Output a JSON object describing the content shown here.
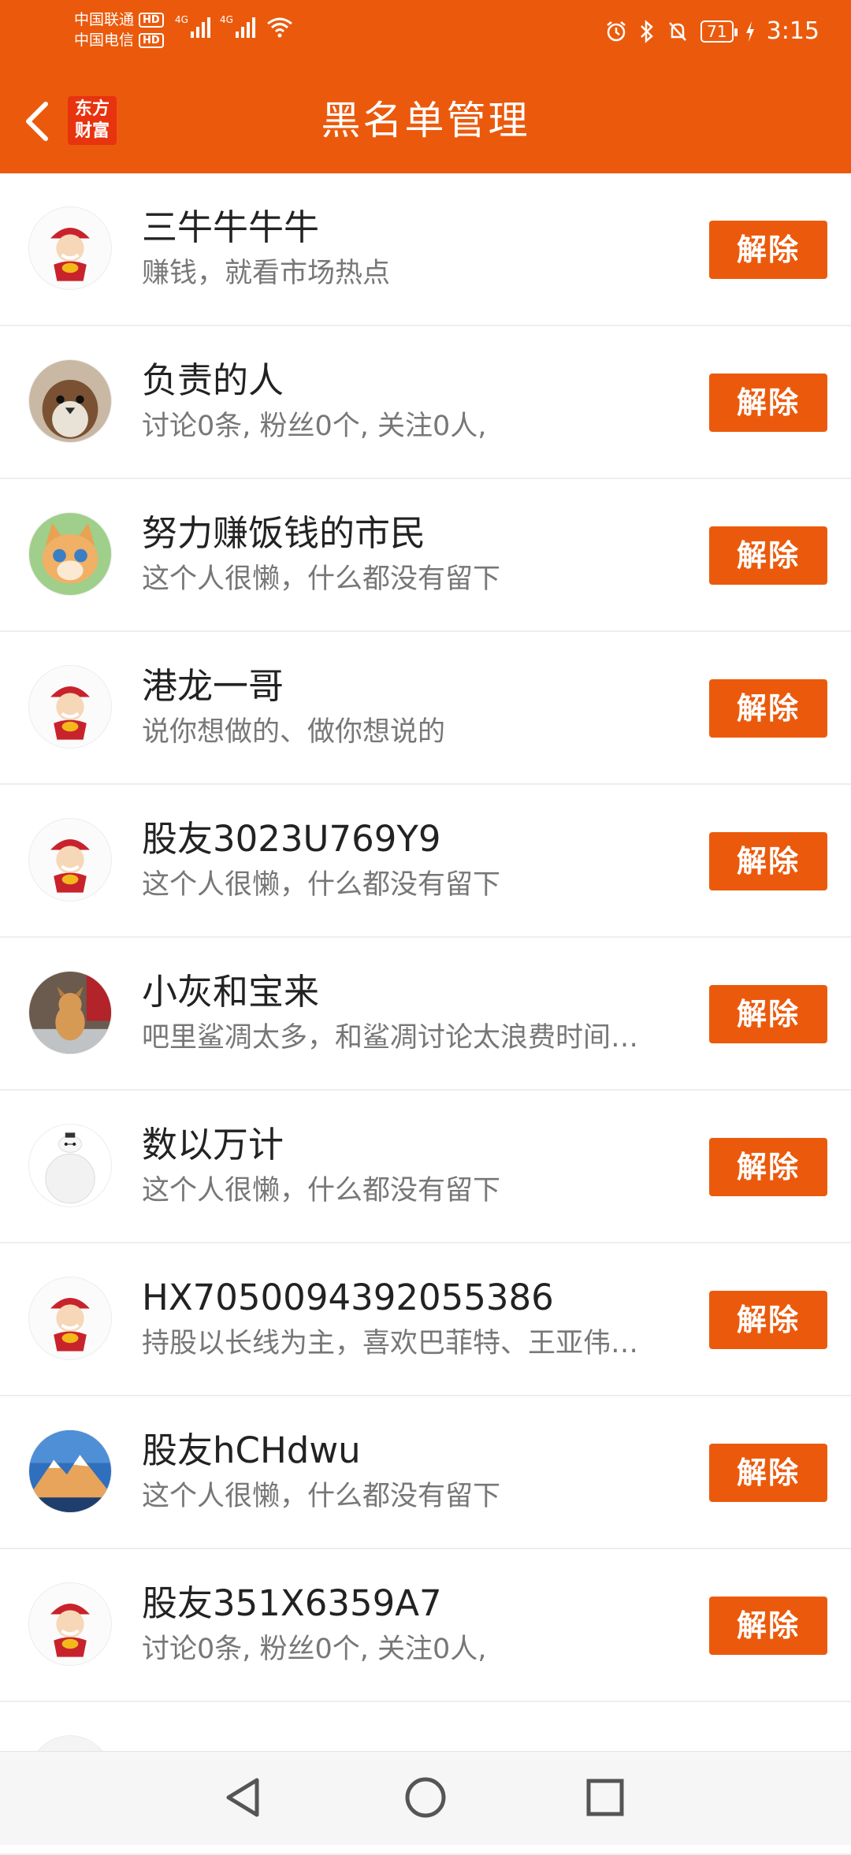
{
  "status_bar": {
    "carrier1": "中国联通",
    "carrier2": "中国电信",
    "hd": "HD",
    "net": "4G",
    "battery": "71",
    "time": "3:15"
  },
  "header": {
    "title": "黑名单管理",
    "logo_text": "东方财富"
  },
  "list": {
    "action_label": "解除",
    "items": [
      {
        "name": "三牛牛牛牛",
        "desc": "赚钱，就看市场热点",
        "avatar": "fortune-god"
      },
      {
        "name": "负责的人",
        "desc": "讨论0条, 粉丝0个, 关注0人,",
        "avatar": "sparrow"
      },
      {
        "name": "努力赚饭钱的市民",
        "desc": "这个人很懒，什么都没有留下",
        "avatar": "cartoon-cat"
      },
      {
        "name": "港龙一哥",
        "desc": "说你想做的、做你想说的",
        "avatar": "fortune-god"
      },
      {
        "name": "股友3023U769Y9",
        "desc": "这个人很懒，什么都没有留下",
        "avatar": "fortune-god"
      },
      {
        "name": "小灰和宝来",
        "desc": "吧里鲨凋太多，和鲨凋讨论太浪费时间…",
        "avatar": "puppy"
      },
      {
        "name": "数以万计",
        "desc": "这个人很懒，什么都没有留下",
        "avatar": "baymax"
      },
      {
        "name": "HX7050094392055386",
        "desc": "持股以长线为主，喜欢巴菲特、王亚伟…",
        "avatar": "fortune-god"
      },
      {
        "name": "股友hCHdwu",
        "desc": "这个人很懒，什么都没有留下",
        "avatar": "mountain"
      },
      {
        "name": "股友351X6359A7",
        "desc": "讨论0条, 粉丝0个, 关注0人,",
        "avatar": "fortune-god"
      }
    ]
  },
  "colors": {
    "brand": "#EB5A0C",
    "logo_red": "#E8330F"
  },
  "nav_bar": {
    "icons": [
      "back-triangle-icon",
      "home-circle-icon",
      "recents-square-icon"
    ]
  }
}
